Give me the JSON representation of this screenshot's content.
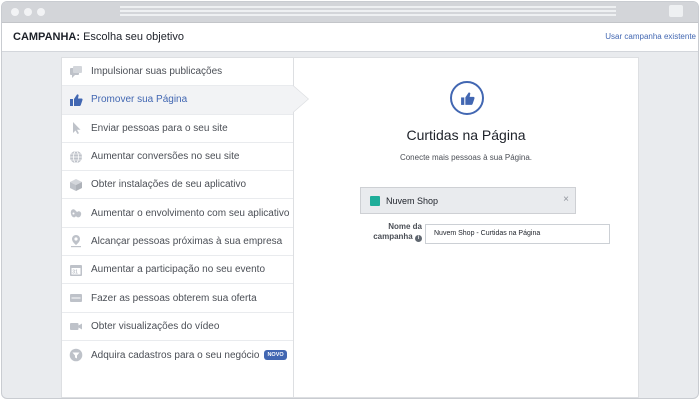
{
  "header": {
    "title_bold": "CAMPANHA:",
    "title_rest": "Escolha seu objetivo",
    "link": "Usar campanha existente"
  },
  "sidebar": {
    "items": [
      {
        "label": "Impulsionar suas publicações",
        "icon": "comments-icon"
      },
      {
        "label": "Promover sua Página",
        "icon": "thumbs-up-icon",
        "active": true
      },
      {
        "label": "Enviar pessoas para o seu site",
        "icon": "cursor-icon"
      },
      {
        "label": "Aumentar conversões no seu site",
        "icon": "globe-icon"
      },
      {
        "label": "Obter instalações de seu aplicativo",
        "icon": "cube-icon"
      },
      {
        "label": "Aumentar o envolvimento com seu aplicativo",
        "icon": "gamepad-icon"
      },
      {
        "label": "Alcançar pessoas próximas à sua empresa",
        "icon": "location-pin-icon"
      },
      {
        "label": "Aumentar a participação no seu evento",
        "icon": "calendar-icon"
      },
      {
        "label": "Fazer as pessoas obterem sua oferta",
        "icon": "ticket-icon"
      },
      {
        "label": "Obter visualizações do vídeo",
        "icon": "video-camera-icon"
      },
      {
        "label": "Adquira cadastros para o seu negócio",
        "icon": "funnel-icon",
        "badge": "NOVO"
      }
    ]
  },
  "main": {
    "icon": "thumbs-up-icon",
    "title": "Curtidas na Página",
    "subtitle": "Conecte mais pessoas à sua Página.",
    "page_selector": {
      "name": "Nuvem Shop",
      "close": "×"
    },
    "campaign_name_label_1": "Nome da",
    "campaign_name_label_2": "campanha",
    "campaign_name_info": "i",
    "campaign_name_value": "Nuvem Shop - Curtidas na Página"
  },
  "colors": {
    "accent": "#4267b2",
    "background": "#e9ebee",
    "page_thumb": "#1fae9a"
  }
}
